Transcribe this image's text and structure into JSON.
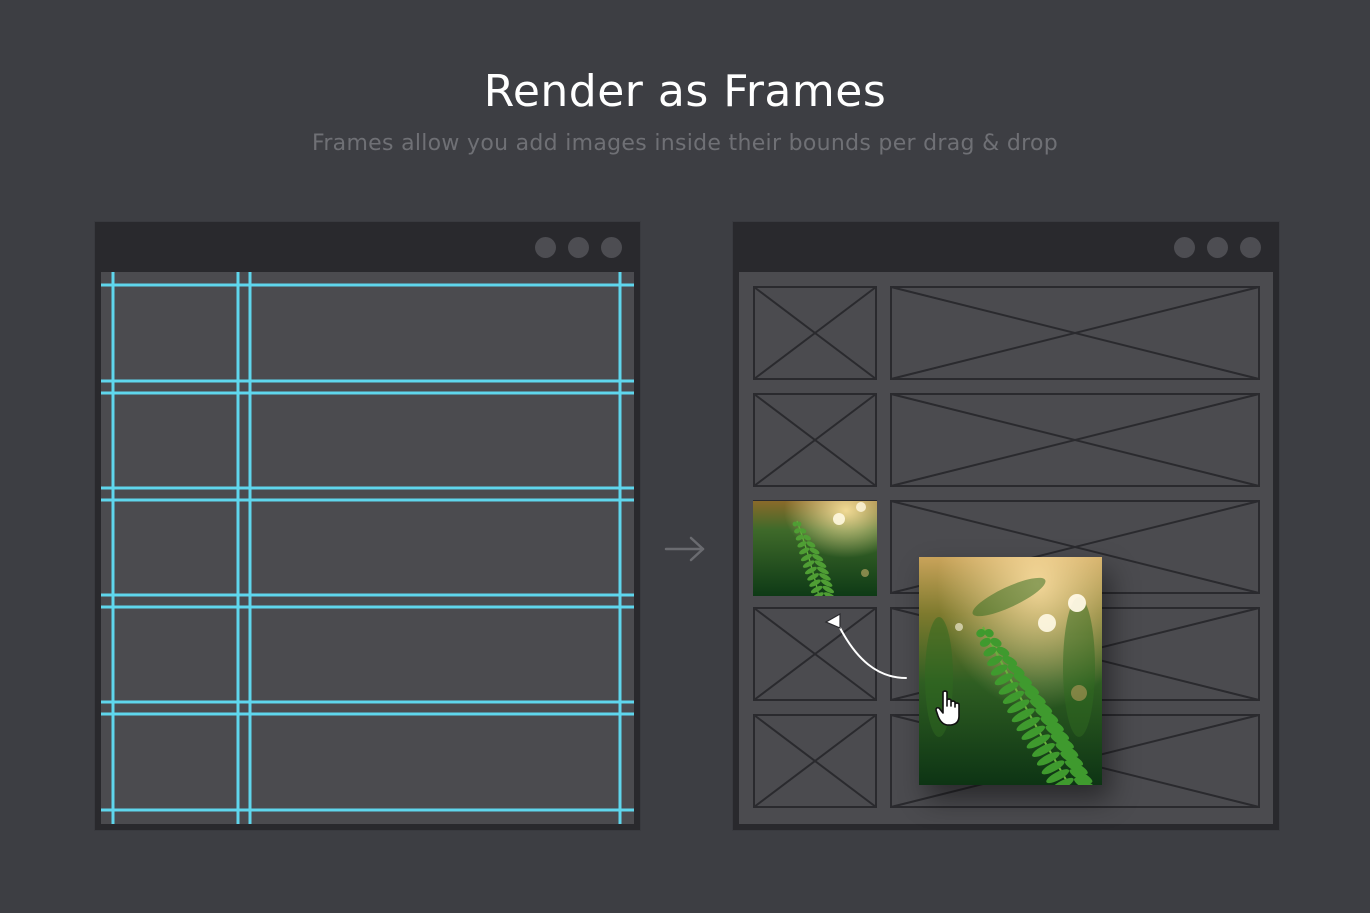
{
  "header": {
    "title": "Render as Frames",
    "subtitle": "Frames allow you add images inside their bounds per drag & drop"
  },
  "colors": {
    "background": "#3d3e43",
    "window_chrome": "#29292d",
    "canvas": "#4b4b4f",
    "guide_line": "#5fd6ec",
    "frame_line": "#2a2a2e",
    "dot": "#4d4d52"
  },
  "icons": {
    "flow_arrow": "arrow-right-icon",
    "drag_arrow": "curved-arrow-icon",
    "cursor": "hand-cursor-icon",
    "window_dots": "window-control-icon",
    "frame_placeholder": "image-placeholder-icon",
    "photo": "fern-photo"
  }
}
